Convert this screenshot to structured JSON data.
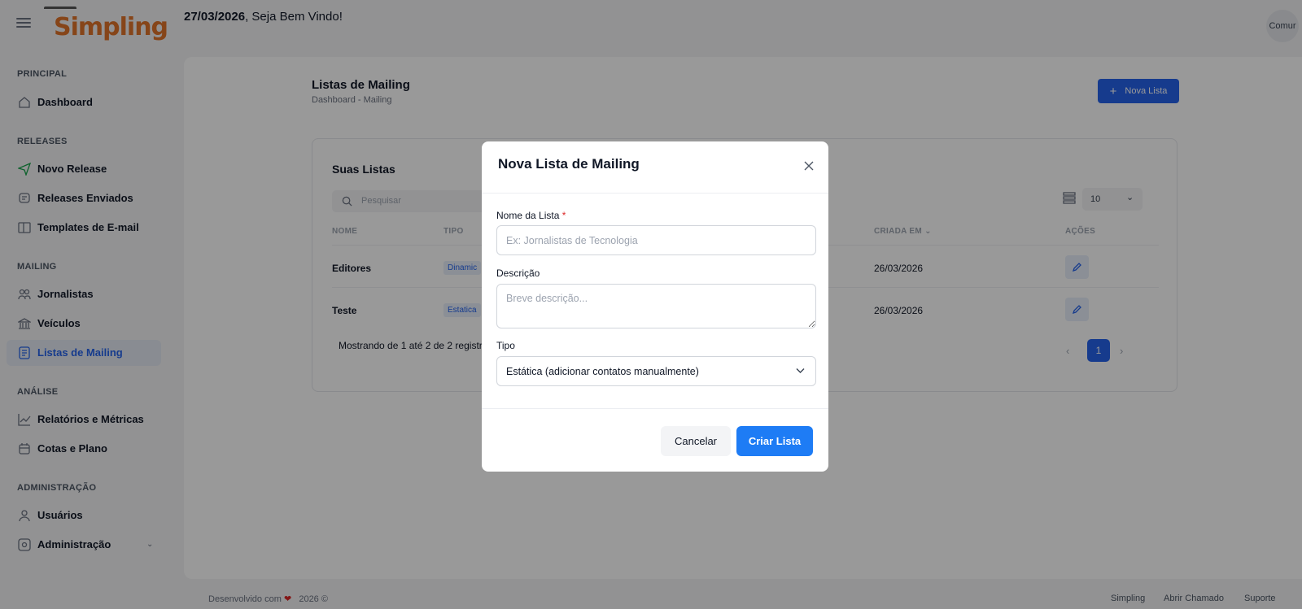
{
  "header": {
    "logo_text": "Simpling",
    "date": "27/03/2026",
    "greeting": ", Seja Bem Vindo!",
    "avatar_alt": "Comur"
  },
  "sidebar": {
    "sections": [
      {
        "title": "PRINCIPAL",
        "items": [
          {
            "label": "Dashboard",
            "icon": "home-icon"
          }
        ]
      },
      {
        "title": "RELEASES",
        "items": [
          {
            "label": "Novo Release",
            "icon": "send-icon"
          },
          {
            "label": "Releases Enviados",
            "icon": "message-icon"
          },
          {
            "label": "Templates de E-mail",
            "icon": "template-icon"
          }
        ]
      },
      {
        "title": "MAILING",
        "items": [
          {
            "label": "Jornalistas",
            "icon": "users-icon"
          },
          {
            "label": "Veículos",
            "icon": "bank-icon"
          },
          {
            "label": "Listas de Mailing",
            "icon": "list-icon",
            "active": true
          }
        ]
      },
      {
        "title": "ANÁLISE",
        "items": [
          {
            "label": "Relatórios e Métricas",
            "icon": "chart-icon"
          },
          {
            "label": "Cotas e Plano",
            "icon": "calendar-icon"
          }
        ]
      },
      {
        "title": "ADMINISTRAÇÃO",
        "items": [
          {
            "label": "Usuários",
            "icon": "user-icon"
          },
          {
            "label": "Administração",
            "icon": "admin-icon"
          }
        ]
      }
    ]
  },
  "main": {
    "title": "Listas de Mailing",
    "breadcrumb": "Dashboard  -  Mailing",
    "new_button": "Nova Lista",
    "card": {
      "title": "Suas Listas",
      "search_placeholder": "Pesquisar",
      "page_size": "10",
      "columns": [
        "NOME",
        "TIPO",
        "CRIADA EM",
        "AÇÕES"
      ],
      "rows": [
        {
          "name": "Editores",
          "type": "Dinamic",
          "created": "26/03/2026"
        },
        {
          "name": "Teste",
          "type": "Estatica",
          "created": "26/03/2026"
        }
      ],
      "showing": "Mostrando de 1 até 2 de 2 registro",
      "current_page": "1"
    }
  },
  "footer": {
    "dev_text": "Desenvolvido com",
    "year": "2026 ©",
    "links": [
      "Simpling",
      "Abrir Chamado",
      "Suporte"
    ]
  },
  "modal": {
    "title": "Nova Lista de Mailing",
    "name_label": "Nome da Lista",
    "required_mark": "*",
    "name_placeholder": "Ex: Jornalistas de Tecnologia",
    "desc_label": "Descrição",
    "desc_placeholder": "Breve descrição...",
    "type_label": "Tipo",
    "type_value": "Estática (adicionar contatos manualmente)",
    "cancel": "Cancelar",
    "create": "Criar Lista"
  },
  "colors": {
    "primary": "#2563eb",
    "logo": "#e0732a",
    "overlay": "rgba(0,0,0,0.4)"
  }
}
